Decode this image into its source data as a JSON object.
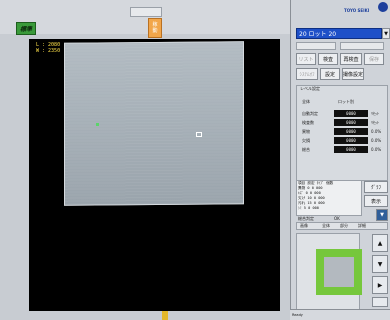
{
  "left_badge": "標準",
  "top_center_button": {
    "line1": "稼",
    "line2": "動"
  },
  "coords": {
    "line1": "L : 2080",
    "line2": "W : 2350"
  },
  "brand": "TOYO SEIKI",
  "side": {
    "combo_value": "20 ロット 20",
    "buttons_row1": [
      "リスト",
      "検査",
      "再検査",
      "保存"
    ],
    "buttons_row2": [
      "ｼｽﾃﾑｵﾌ",
      "設定",
      "撮像設定"
    ],
    "panel_header": "レベル設定",
    "radio_left": "全体",
    "radio_right": "ロット別",
    "params": [
      {
        "label": "自動判定",
        "value": "0000",
        "tag": "ﾘｾｯﾄ"
      },
      {
        "label": "検査数",
        "value": "0000",
        "tag": "ﾘｾｯﾄ"
      },
      {
        "label": "異物",
        "value": "0000",
        "tag": "0.0%"
      },
      {
        "label": "欠損",
        "value": "0000",
        "tag": "0.0%"
      },
      {
        "label": "総合",
        "value": "0000",
        "tag": "0.0%"
      }
    ],
    "table_headers": [
      "項目",
      "設定",
      "ﾀｲﾌﾟ",
      "個数"
    ],
    "table_rows": [
      {
        "name": "異物",
        "a": "0",
        "b": "0",
        "c": "000"
      },
      {
        "name": "ｷｽﾞ",
        "a": "0",
        "b": "0",
        "c": "000"
      },
      {
        "name": "欠け",
        "a": "10",
        "b": "0",
        "c": "000"
      },
      {
        "name": "汚れ",
        "a": "15",
        "b": "0",
        "c": "000"
      },
      {
        "name": "ｼﾐ",
        "a": "5",
        "b": "0",
        "c": "000"
      }
    ],
    "summary_label": "総合判定",
    "summary_value": "OK",
    "extra_buttons": [
      "ｸﾞﾗﾌ",
      "表示"
    ],
    "tabs": [
      "画像",
      "全体",
      "部分",
      "詳細"
    ],
    "status_text": "Ready"
  }
}
